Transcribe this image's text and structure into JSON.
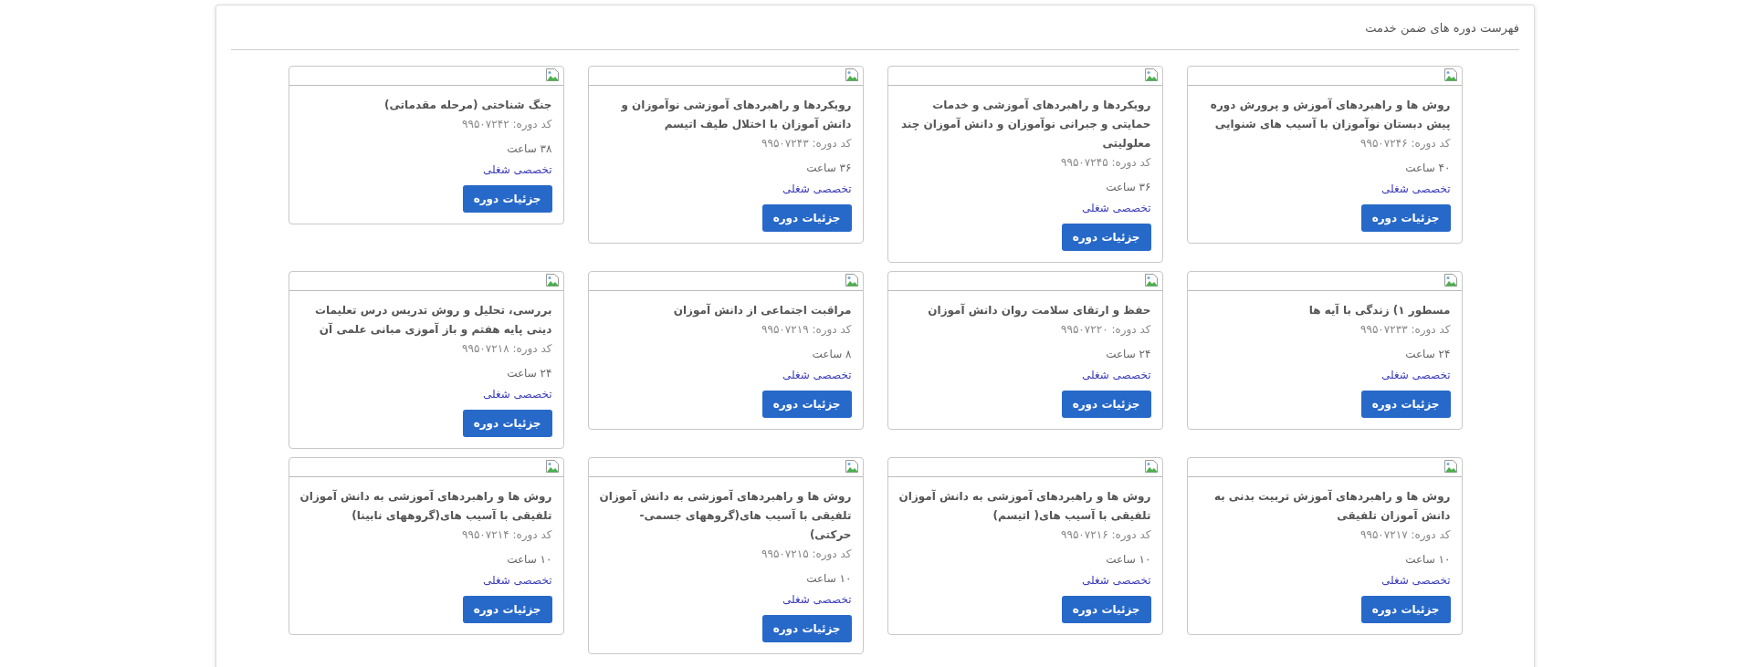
{
  "panel": {
    "title": "فهرست دوره های ضمن خدمت"
  },
  "courses": [
    {
      "title": "روش ها و راهبردهای آموزش و پرورش دوره پیش دبستان نوآموزان با آسیب های شنوایی",
      "code": "کد دوره: ۹۹۵۰۷۲۴۶",
      "hours": "۴۰ ساعت",
      "category": "تخصصی شغلی",
      "button": "جزئیات دوره"
    },
    {
      "title": "رویکردها و راهبردهای آموزشی و خدمات حمایتی و جبرانی نوآموزان و دانش آموزان چند معلولیتی",
      "code": "کد دوره: ۹۹۵۰۷۲۴۵",
      "hours": "۳۶ ساعت",
      "category": "تخصصی شغلی",
      "button": "جزئیات دوره"
    },
    {
      "title": "رویکردها و راهبردهای آموزشی نوآموزان و دانش آموزان با اختلال طیف اتیسم",
      "code": "کد دوره: ۹۹۵۰۷۲۴۳",
      "hours": "۳۶ ساعت",
      "category": "تخصصی شغلی",
      "button": "جزئیات دوره"
    },
    {
      "title": "جنگ شناختی (مرحله مقدماتی)",
      "code": "کد دوره: ۹۹۵۰۷۲۴۲",
      "hours": "۳۸ ساعت",
      "category": "تخصصی شغلی",
      "button": "جزئیات دوره"
    },
    {
      "title": "مسطور ۱) زندگی با آیه ها",
      "code": "کد دوره: ۹۹۵۰۷۲۳۳",
      "hours": "۲۴ ساعت",
      "category": "تخصصی شغلی",
      "button": "جزئیات دوره"
    },
    {
      "title": "حفظ و ارتقای سلامت روان دانش آموزان",
      "code": "کد دوره: ۹۹۵۰۷۲۲۰",
      "hours": "۲۴ ساعت",
      "category": "تخصصی شغلی",
      "button": "جزئیات دوره"
    },
    {
      "title": "مراقبت اجتماعی از دانش آموزان",
      "code": "کد دوره: ۹۹۵۰۷۲۱۹",
      "hours": "۸ ساعت",
      "category": "تخصصی شغلی",
      "button": "جزئیات دوره"
    },
    {
      "title": "بررسی، تحلیل و روش تدریس درس تعلیمات دینی پایه هفتم و باز آموزی مبانی علمی آن",
      "code": "کد دوره: ۹۹۵۰۷۲۱۸",
      "hours": "۲۴ ساعت",
      "category": "تخصصی شغلی",
      "button": "جزئیات دوره"
    },
    {
      "title": "روش ها و راهبردهای آموزش تربیت بدنی به دانش آموزان تلفیقی",
      "code": "کد دوره: ۹۹۵۰۷۲۱۷",
      "hours": "۱۰ ساعت",
      "category": "تخصصی شغلی",
      "button": "جزئیات دوره"
    },
    {
      "title": "روش ها و راهبردهای آموزشی به دانش آموزان تلفیقی با آسیب های( اتیسم)",
      "code": "کد دوره: ۹۹۵۰۷۲۱۶",
      "hours": "۱۰ ساعت",
      "category": "تخصصی شغلی",
      "button": "جزئیات دوره"
    },
    {
      "title": "روش ها و راهبردهای آموزشی به دانش آموزان تلفیقی با آسیب های(گروههای جسمی- حرکتی)",
      "code": "کد دوره: ۹۹۵۰۷۲۱۵",
      "hours": "۱۰ ساعت",
      "category": "تخصصی شغلی",
      "button": "جزئیات دوره"
    },
    {
      "title": "روش ها و راهبردهای آموزشی به دانش آموزان تلفیقی با آسیب های(گروههای نابینا)",
      "code": "کد دوره: ۹۹۵۰۷۲۱۴",
      "hours": "۱۰ ساعت",
      "category": "تخصصی شغلی",
      "button": "جزئیات دوره"
    }
  ]
}
